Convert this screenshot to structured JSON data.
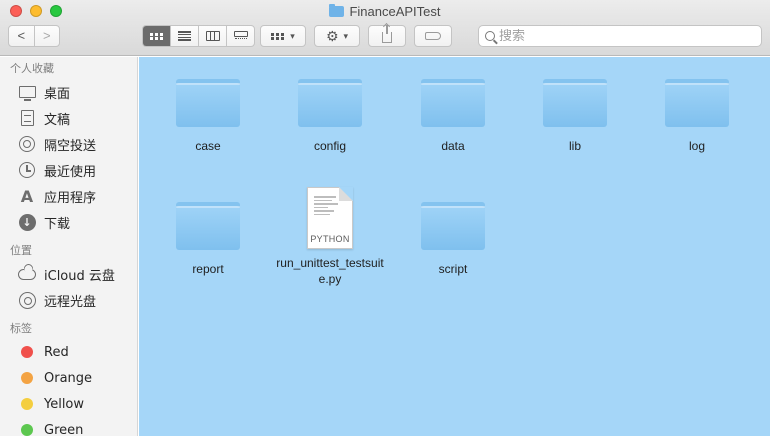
{
  "window": {
    "title": "FinanceAPITest"
  },
  "toolbar": {
    "back_glyph": "<",
    "forward_glyph": ">",
    "action_glyph": "⚙",
    "caret_glyph": "▾"
  },
  "search": {
    "placeholder": "搜索"
  },
  "sidebar": {
    "sections": [
      {
        "header": "个人收藏",
        "items": [
          {
            "label": "桌面",
            "icon": "desktop-icon"
          },
          {
            "label": "文稿",
            "icon": "document-icon"
          },
          {
            "label": "隔空投送",
            "icon": "airdrop-icon"
          },
          {
            "label": "最近使用",
            "icon": "clock-icon"
          },
          {
            "label": "应用程序",
            "icon": "applications-icon"
          },
          {
            "label": "下载",
            "icon": "download-icon"
          }
        ]
      },
      {
        "header": "位置",
        "items": [
          {
            "label": "iCloud 云盘",
            "icon": "cloud-icon"
          },
          {
            "label": "远程光盘",
            "icon": "disc-icon"
          }
        ]
      },
      {
        "header": "标签",
        "items": [
          {
            "label": "Red",
            "color": "#f0504b"
          },
          {
            "label": "Orange",
            "color": "#f3a343"
          },
          {
            "label": "Yellow",
            "color": "#f4ce3f"
          },
          {
            "label": "Green",
            "color": "#5cc74f"
          }
        ]
      }
    ]
  },
  "files": [
    {
      "name": "case",
      "kind": "folder"
    },
    {
      "name": "config",
      "kind": "folder"
    },
    {
      "name": "data",
      "kind": "folder"
    },
    {
      "name": "lib",
      "kind": "folder"
    },
    {
      "name": "log",
      "kind": "folder"
    },
    {
      "name": "report",
      "kind": "folder"
    },
    {
      "name": "run_unittest_testsuite.py",
      "kind": "python",
      "badge": "PYTHON"
    },
    {
      "name": "script",
      "kind": "folder"
    }
  ],
  "colors": {
    "content_bg": "#a5d6f8",
    "folder": "#84c3ef"
  }
}
